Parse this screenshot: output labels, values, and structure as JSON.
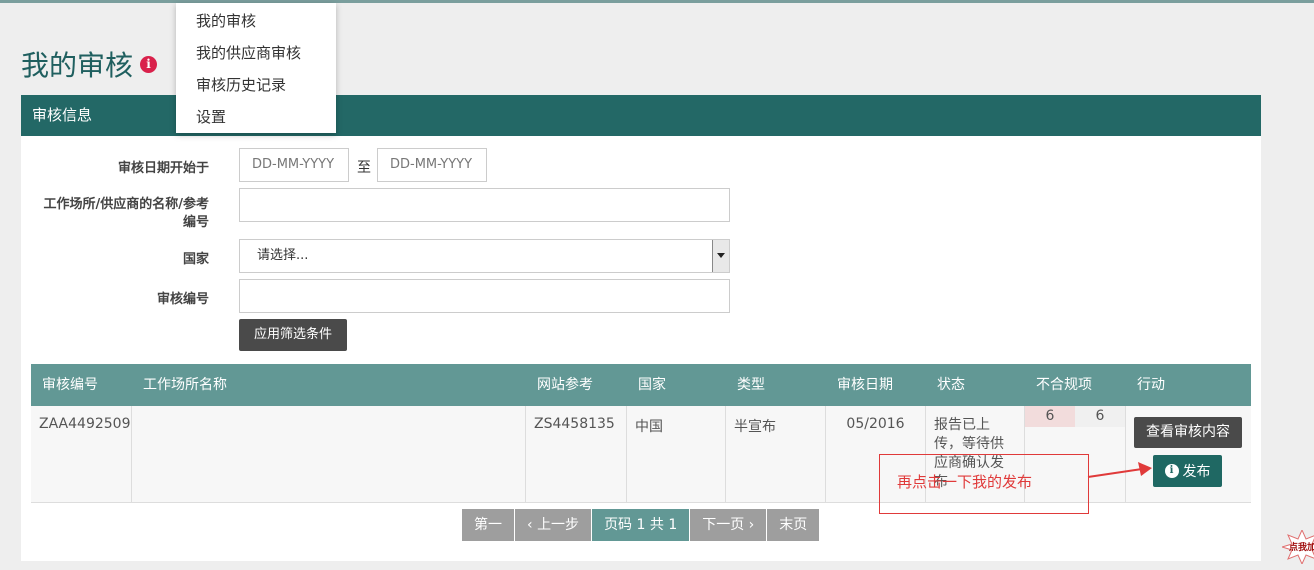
{
  "page": {
    "title": "我的审核",
    "info_glyph": "i"
  },
  "menu": {
    "items": [
      "我的审核",
      "我的供应商审核",
      "审核历史记录",
      "设置"
    ]
  },
  "panel": {
    "header": "审核信息"
  },
  "filters": {
    "date_label": "审核日期开始于",
    "date_from_placeholder": "DD-MM-YYYY",
    "to_label": "至",
    "date_to_placeholder": "DD-MM-YYYY",
    "site_label_line1": "工作场所/供应商的名称/参考",
    "site_label_line2": "编号",
    "country_label": "国家",
    "country_selected": "请选择...",
    "audit_no_label": "审核编号",
    "apply_button": "应用筛选条件"
  },
  "table": {
    "headers": [
      "审核编号",
      "工作场所名称",
      "网站参考",
      "国家",
      "类型",
      "审核日期",
      "状态",
      "不合规项",
      "行动"
    ],
    "rows": [
      {
        "audit_no": "ZAA4492509",
        "site_name": "",
        "site_ref": "ZS4458135",
        "country": "中国",
        "type": "半宣布",
        "date": "05/2016",
        "status": "报告已上传，等待供应商确认发布",
        "nc_a": "6",
        "nc_b": "6",
        "view_button": "查看审核内容",
        "publish_button": "发布"
      }
    ]
  },
  "pagination": {
    "first": "第一",
    "prev": "上一步",
    "current": "页码 1 共 1",
    "next": "下一页",
    "last": "末页"
  },
  "annotation": {
    "callout_text": "再点击一下我的发布",
    "corner_badge": "点我加"
  },
  "colors": {
    "header_teal": "#236866",
    "table_header": "#629895",
    "accent_red": "#e03a3a"
  }
}
